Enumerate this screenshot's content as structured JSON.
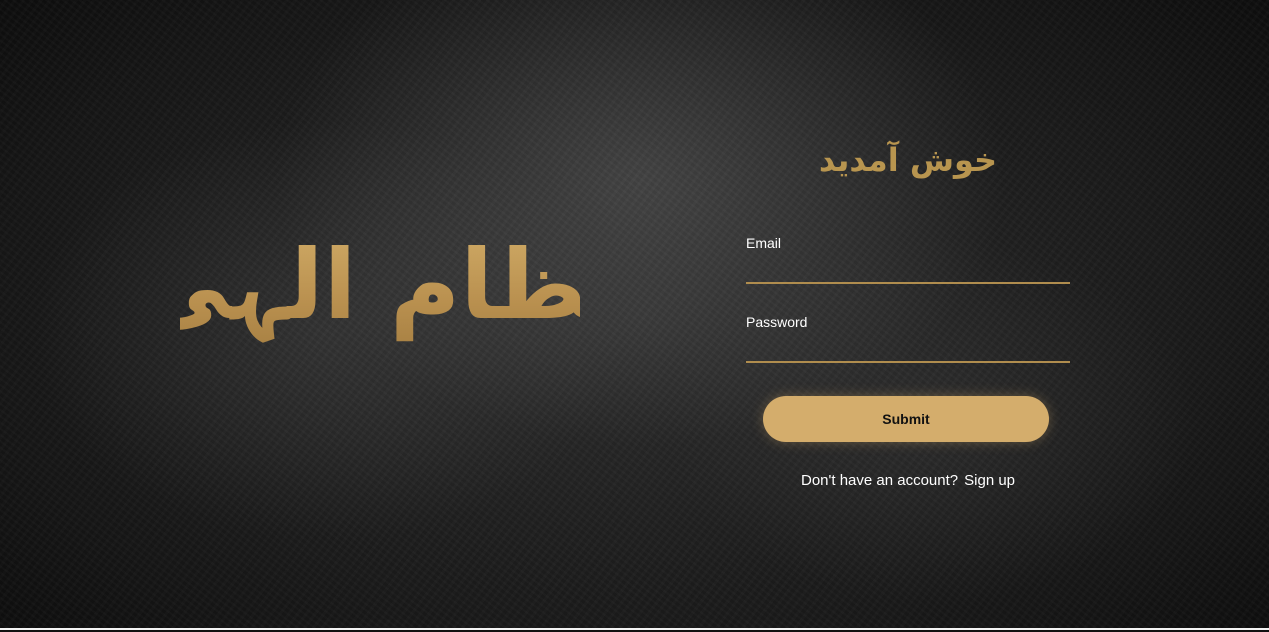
{
  "brand": {
    "title": "نظام الہی"
  },
  "login": {
    "heading": "خوش آمدید",
    "email_label": "Email",
    "email_value": "",
    "password_label": "Password",
    "password_value": "",
    "submit_label": "Submit",
    "signup_prompt": "Don't have an account?",
    "signup_link": "Sign up"
  },
  "colors": {
    "gold": "#d4ad6c",
    "gold_dark": "#b08d4e",
    "background": "#1a1a1a",
    "text": "#ffffff"
  }
}
